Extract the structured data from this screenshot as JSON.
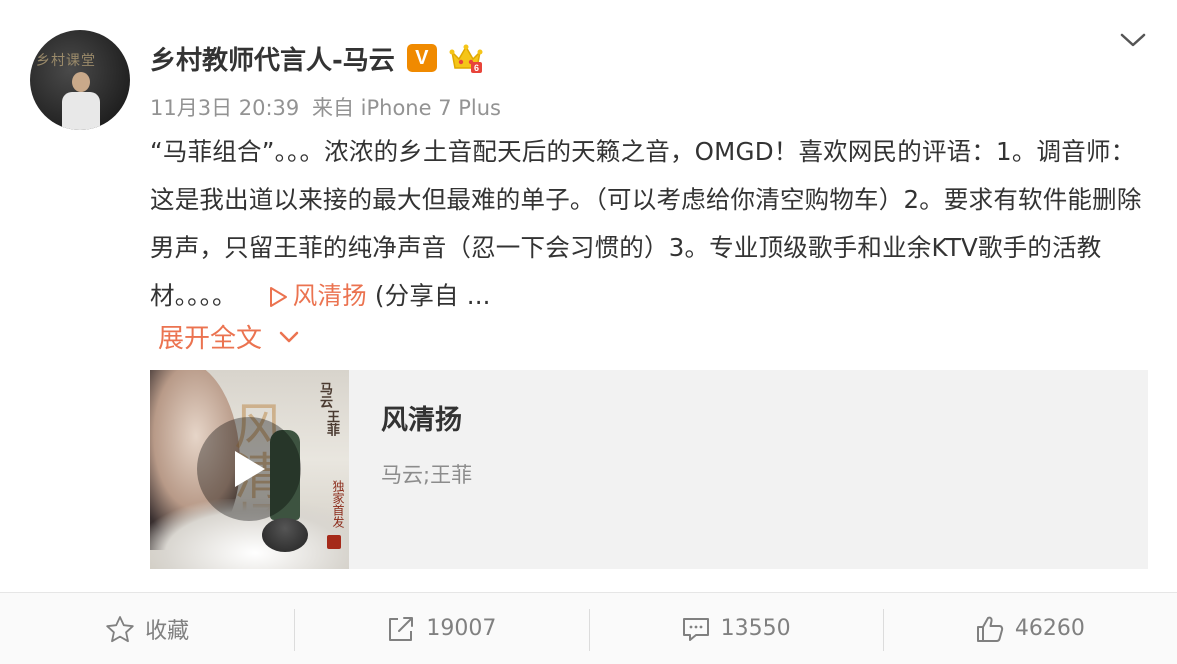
{
  "user": {
    "name": "乡村教师代言人-马云",
    "avatar_banner": "乡村课堂",
    "verified_badge": "V",
    "member_badge_icon": "crown-icon"
  },
  "post": {
    "meta_time": "11月3日 20:39",
    "meta_source": "来自 iPhone 7 Plus",
    "text": "“马菲组合”。。。浓浓的乡土音配天后的天籁之音，OMGD！喜欢网民的评语：1。调音师：这是我出道以来接的最大但最难的单子。（可以考虑给你清空购物车）2。要求有软件能删除男声，只留王菲的纯净声音（忍一下会习惯的）3。专业顶级歌手和业余KTV歌手的活教材。。。。",
    "music_link_label": "风清扬",
    "share_suffix": "(分享自 ...",
    "expand_label": "展开全文"
  },
  "music_card": {
    "title": "风清扬",
    "artists": "马云;王菲",
    "cover": {
      "artist1": "马云",
      "artist2": "王菲",
      "exclusive": "独家首发",
      "big_char": "风清扬"
    }
  },
  "actions": {
    "favorite_label": "收藏",
    "repost_count": "19007",
    "comment_count": "13550",
    "like_count": "46260"
  },
  "colors": {
    "accent": "#eb7350",
    "vip_orange": "#f08a00",
    "text": "#333333",
    "meta": "#939393"
  }
}
